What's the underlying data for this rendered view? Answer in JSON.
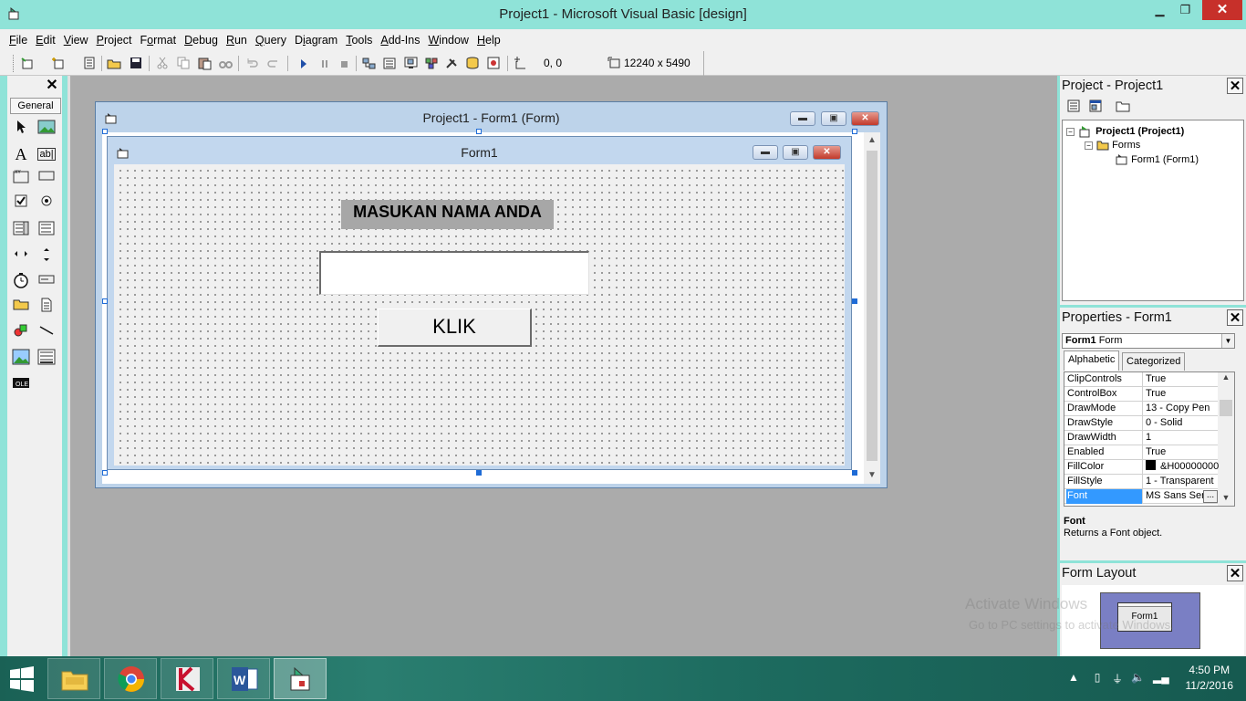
{
  "window": {
    "title": "Project1 - Microsoft Visual Basic [design]"
  },
  "menu": [
    {
      "label": "File",
      "u": "F",
      "rest": "ile"
    },
    {
      "label": "Edit",
      "u": "E",
      "rest": "dit"
    },
    {
      "label": "View",
      "u": "V",
      "rest": "iew"
    },
    {
      "label": "Project",
      "u": "P",
      "rest": "roject"
    },
    {
      "label": "Format",
      "pre": "F",
      "u": "o",
      "rest": "rmat"
    },
    {
      "label": "Debug",
      "u": "D",
      "rest": "ebug"
    },
    {
      "label": "Run",
      "u": "R",
      "rest": "un"
    },
    {
      "label": "Query",
      "u": "Q",
      "rest": "uery"
    },
    {
      "label": "Diagram",
      "pre": "D",
      "u": "i",
      "rest": "agram"
    },
    {
      "label": "Tools",
      "u": "T",
      "rest": "ools"
    },
    {
      "label": "Add-Ins",
      "u": "A",
      "rest": "dd-Ins"
    },
    {
      "label": "Window",
      "u": "W",
      "rest": "indow"
    },
    {
      "label": "Help",
      "u": "H",
      "rest": "elp"
    }
  ],
  "toolbar": {
    "position": "0, 0",
    "size": "12240 x 5490"
  },
  "toolbox": {
    "tab_label": "General"
  },
  "designer": {
    "title": "Project1 - Form1 (Form)"
  },
  "form": {
    "caption": "Form1",
    "label_text": "MASUKAN NAMA ANDA",
    "textbox_value": "",
    "button_text": "KLIK"
  },
  "project_panel": {
    "title": "Project - Project1",
    "root": "Project1 (Project1)",
    "folder": "Forms",
    "item": "Form1 (Form1)"
  },
  "properties_panel": {
    "title": "Properties - Form1",
    "object_name": "Form1",
    "object_type": "Form",
    "tabs": [
      "Alphabetic",
      "Categorized"
    ],
    "rows": [
      {
        "name": "ClipControls",
        "value": "True"
      },
      {
        "name": "ControlBox",
        "value": "True"
      },
      {
        "name": "DrawMode",
        "value": "13 - Copy Pen"
      },
      {
        "name": "DrawStyle",
        "value": "0 - Solid"
      },
      {
        "name": "DrawWidth",
        "value": "1"
      },
      {
        "name": "Enabled",
        "value": "True"
      },
      {
        "name": "FillColor",
        "value": "&H00000000"
      },
      {
        "name": "FillStyle",
        "value": "1 - Transparent"
      },
      {
        "name": "Font",
        "value": "MS Sans Ser"
      }
    ],
    "selected_row": "Font",
    "desc_title": "Font",
    "desc_text": "Returns a Font object."
  },
  "layout_panel": {
    "title": "Form Layout",
    "form_label": "Form1"
  },
  "watermark": {
    "line1": "Activate Windows",
    "line2": "Go to PC settings to activate Windows."
  },
  "taskbar": {
    "time": "4:50 PM",
    "date": "11/2/2016"
  },
  "colors": {
    "titlebar": "#8fe3d8",
    "workspace": "#ababab",
    "selection": "#3399ff",
    "close": "#c7302a"
  }
}
